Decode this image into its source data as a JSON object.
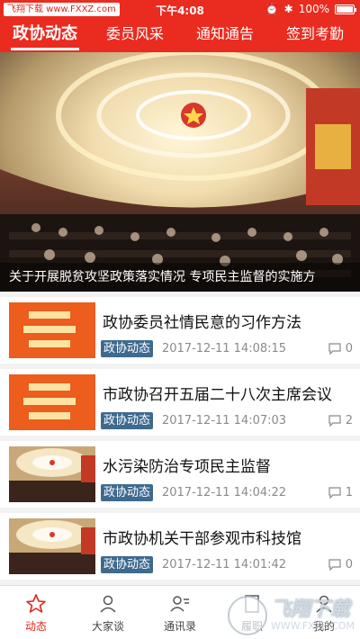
{
  "status_bar": {
    "watermark": "飞翔下载 www.FXXZ.com",
    "time": "下午4:08",
    "battery": "100%"
  },
  "tabs": [
    {
      "label": "政协动态",
      "active": true
    },
    {
      "label": "委员风采",
      "active": false
    },
    {
      "label": "通知通告",
      "active": false
    },
    {
      "label": "签到考勤",
      "active": false
    }
  ],
  "banner": {
    "caption": "关于开展脱贫攻坚政策落实情况 专项民主监督的实施方"
  },
  "news": [
    {
      "title": "政协委员社情民意的习作方法",
      "tag": "政协动态",
      "time": "2017-12-11 14:08:15",
      "comments": "0",
      "thumb": "red-banner"
    },
    {
      "title": "市政协召开五届二十八次主席会议",
      "tag": "政协动态",
      "time": "2017-12-11 14:07:03",
      "comments": "2",
      "thumb": "red-banner"
    },
    {
      "title": "水污染防治专项民主监督",
      "tag": "政协动态",
      "time": "2017-12-11 14:04:22",
      "comments": "1",
      "thumb": "hall"
    },
    {
      "title": "市政协机关干部参观市科技馆",
      "tag": "政协动态",
      "time": "2017-12-11 14:01:42",
      "comments": "0",
      "thumb": "hall"
    }
  ],
  "bottom_nav": [
    {
      "label": "动态",
      "icon": "star-icon",
      "active": true
    },
    {
      "label": "大家谈",
      "icon": "person-icon",
      "active": false
    },
    {
      "label": "通讯录",
      "icon": "contacts-icon",
      "active": false
    },
    {
      "label": "履职",
      "icon": "duty-icon",
      "active": false
    },
    {
      "label": "我的",
      "icon": "profile-icon",
      "active": false
    }
  ],
  "site_watermark": {
    "text": "飞翔下载",
    "url": "WWW.FXXZ.COM"
  },
  "colors": {
    "brand_red": "#ea2b1f",
    "tag_blue": "#3f6a8f"
  }
}
